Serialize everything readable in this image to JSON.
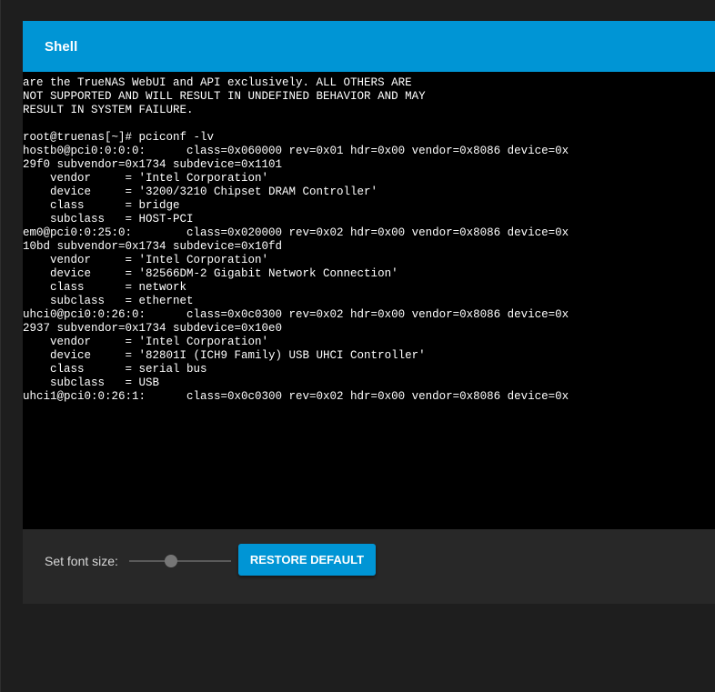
{
  "card": {
    "title": "Shell"
  },
  "terminal": {
    "lines": [
      "are the TrueNAS WebUI and API exclusively. ALL OTHERS ARE",
      "NOT SUPPORTED AND WILL RESULT IN UNDEFINED BEHAVIOR AND MAY",
      "RESULT IN SYSTEM FAILURE.",
      "",
      "root@truenas[~]# pciconf -lv",
      "hostb0@pci0:0:0:0:      class=0x060000 rev=0x01 hdr=0x00 vendor=0x8086 device=0x",
      "29f0 subvendor=0x1734 subdevice=0x1101",
      "    vendor     = 'Intel Corporation'",
      "    device     = '3200/3210 Chipset DRAM Controller'",
      "    class      = bridge",
      "    subclass   = HOST-PCI",
      "em0@pci0:0:25:0:        class=0x020000 rev=0x02 hdr=0x00 vendor=0x8086 device=0x",
      "10bd subvendor=0x1734 subdevice=0x10fd",
      "    vendor     = 'Intel Corporation'",
      "    device     = '82566DM-2 Gigabit Network Connection'",
      "    class      = network",
      "    subclass   = ethernet",
      "uhci0@pci0:0:26:0:      class=0x0c0300 rev=0x02 hdr=0x00 vendor=0x8086 device=0x",
      "2937 subvendor=0x1734 subdevice=0x10e0",
      "    vendor     = 'Intel Corporation'",
      "    device     = '82801I (ICH9 Family) USB UHCI Controller'",
      "    class      = serial bus",
      "    subclass   = USB",
      "uhci1@pci0:0:26:1:      class=0x0c0300 rev=0x02 hdr=0x00 vendor=0x8086 device=0x"
    ]
  },
  "controls": {
    "font_size_label": "Set font size:",
    "font_size_slider_fraction": 0.4,
    "restore_button_label": "RESTORE DEFAULT"
  },
  "colors": {
    "accent": "#0095d5",
    "terminal_bg": "#000000",
    "terminal_fg": "#ffffff",
    "card_bg": "#282828",
    "page_bg": "#1e1e1e"
  }
}
